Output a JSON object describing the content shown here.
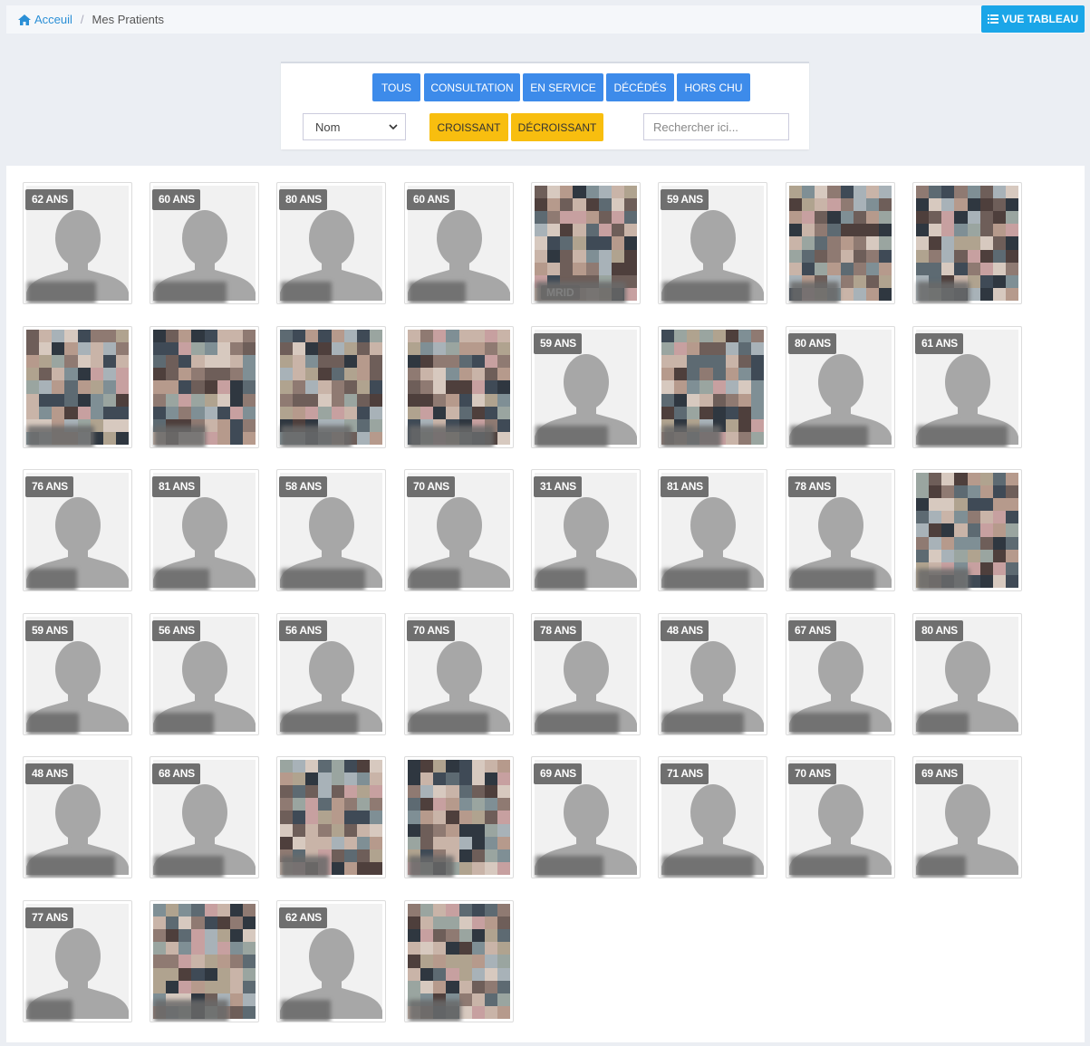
{
  "breadcrumb": {
    "home": "Acceuil",
    "current": "Mes Pratients"
  },
  "view_button": {
    "label": "VUE TABLEAU",
    "icon": "list-icon"
  },
  "filters": {
    "tabs": [
      "TOUS",
      "CONSULTATION",
      "EN SERVICE",
      "DÉCÉDÉS",
      "HORS CHU"
    ],
    "sort_field": "Nom",
    "sort_asc": "CROISSANT",
    "sort_desc": "DÉCROISSANT",
    "search_placeholder": "Rechercher ici..."
  },
  "colors": {
    "primary": "#3d8bea",
    "warning": "#f8be0f",
    "info": "#1aa6e8",
    "link": "#2a8fd6"
  },
  "patients": [
    {
      "age": "62 ANS",
      "photo": false
    },
    {
      "age": "60 ANS",
      "photo": false
    },
    {
      "age": "80 ANS",
      "photo": false
    },
    {
      "age": "60 ANS",
      "photo": false
    },
    {
      "age": "",
      "photo": true,
      "label": "MRID"
    },
    {
      "age": "59 ANS",
      "photo": false
    },
    {
      "age": "",
      "photo": true
    },
    {
      "age": "",
      "photo": true
    },
    {
      "age": "",
      "photo": true
    },
    {
      "age": "",
      "photo": true
    },
    {
      "age": "",
      "photo": true
    },
    {
      "age": "",
      "photo": true
    },
    {
      "age": "59 ANS",
      "photo": false
    },
    {
      "age": "",
      "photo": true
    },
    {
      "age": "80 ANS",
      "photo": false
    },
    {
      "age": "61 ANS",
      "photo": false
    },
    {
      "age": "76 ANS",
      "photo": false
    },
    {
      "age": "81 ANS",
      "photo": false
    },
    {
      "age": "58 ANS",
      "photo": false
    },
    {
      "age": "70 ANS",
      "photo": false
    },
    {
      "age": "31 ANS",
      "photo": false
    },
    {
      "age": "81 ANS",
      "photo": false
    },
    {
      "age": "78 ANS",
      "photo": false
    },
    {
      "age": "",
      "photo": true
    },
    {
      "age": "59 ANS",
      "photo": false
    },
    {
      "age": "56 ANS",
      "photo": false
    },
    {
      "age": "56 ANS",
      "photo": false
    },
    {
      "age": "70 ANS",
      "photo": false
    },
    {
      "age": "78 ANS",
      "photo": false
    },
    {
      "age": "48 ANS",
      "photo": false
    },
    {
      "age": "67 ANS",
      "photo": false
    },
    {
      "age": "80 ANS",
      "photo": false
    },
    {
      "age": "48 ANS",
      "photo": false
    },
    {
      "age": "68 ANS",
      "photo": false
    },
    {
      "age": "",
      "photo": true
    },
    {
      "age": "",
      "photo": true
    },
    {
      "age": "69 ANS",
      "photo": false
    },
    {
      "age": "71 ANS",
      "photo": false
    },
    {
      "age": "70 ANS",
      "photo": false
    },
    {
      "age": "69 ANS",
      "photo": false
    },
    {
      "age": "77 ANS",
      "photo": false
    },
    {
      "age": "",
      "photo": true
    },
    {
      "age": "62 ANS",
      "photo": false
    },
    {
      "age": "",
      "photo": true
    }
  ]
}
